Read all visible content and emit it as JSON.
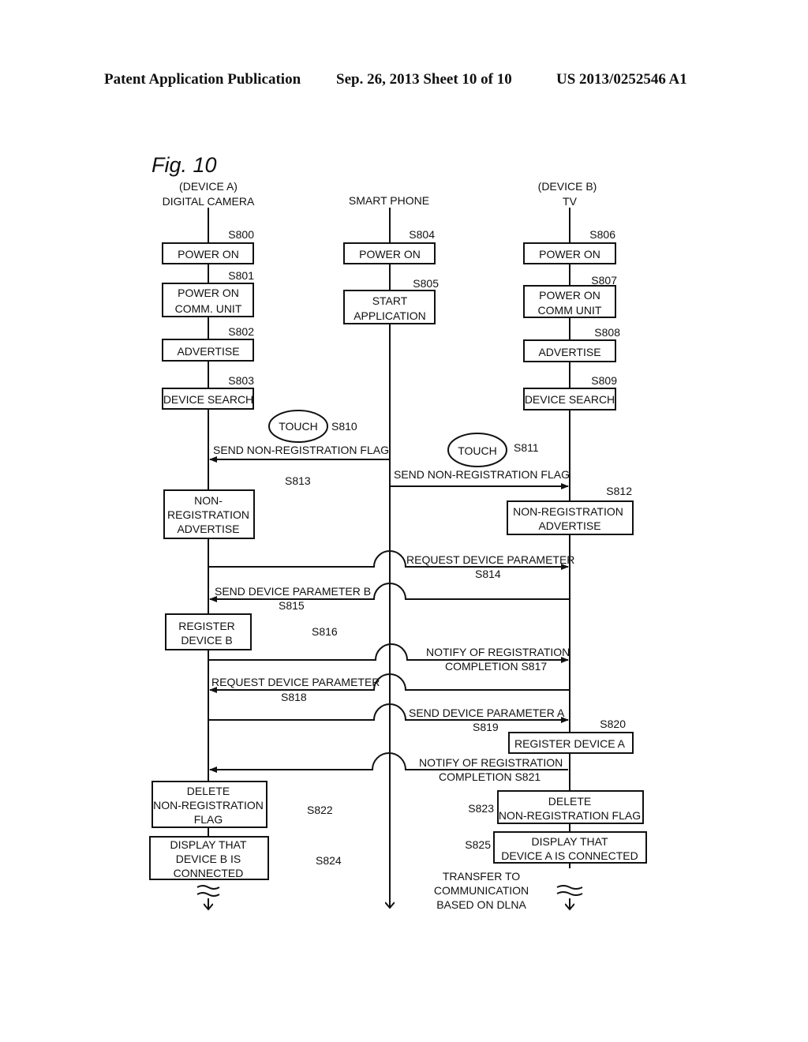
{
  "header": {
    "left": "Patent Application Publication",
    "middle": "Sep. 26, 2013   Sheet 10 of 10",
    "right": "US 2013/0252546 A1"
  },
  "figure": {
    "title": "Fig. 10",
    "lanes": {
      "device_a": {
        "line1": "(DEVICE A)",
        "line2": "DIGITAL CAMERA"
      },
      "phone": {
        "line1": "",
        "line2": "SMART PHONE"
      },
      "device_b": {
        "line1": "(DEVICE B)",
        "line2": "TV"
      }
    },
    "steps": {
      "s800": {
        "id": "S800",
        "text": [
          "POWER ON"
        ]
      },
      "s801": {
        "id": "S801",
        "text": [
          "POWER ON",
          "COMM. UNIT"
        ]
      },
      "s802": {
        "id": "S802",
        "text": [
          "ADVERTISE"
        ]
      },
      "s803": {
        "id": "S803",
        "text": [
          "DEVICE SEARCH"
        ]
      },
      "s804": {
        "id": "S804",
        "text": [
          "POWER ON"
        ]
      },
      "s805": {
        "id": "S805",
        "text": [
          "START",
          "APPLICATION"
        ]
      },
      "s806": {
        "id": "S806",
        "text": [
          "POWER ON"
        ]
      },
      "s807": {
        "id": "S807",
        "text": [
          "POWER ON",
          "COMM UNIT"
        ]
      },
      "s808": {
        "id": "S808",
        "text": [
          "ADVERTISE"
        ]
      },
      "s809": {
        "id": "S809",
        "text": [
          "DEVICE SEARCH"
        ]
      },
      "s810": {
        "id": "S810",
        "text": [
          "TOUCH"
        ]
      },
      "s811": {
        "id": "S811",
        "text": [
          "TOUCH"
        ]
      },
      "s812": {
        "id": "S812",
        "text": [
          "NON-REGISTRATION",
          "ADVERTISE"
        ]
      },
      "s813": {
        "id": "S813",
        "text": [
          "NON-",
          "REGISTRATION",
          "ADVERTISE"
        ]
      },
      "s816": {
        "id": "S816",
        "text": [
          "REGISTER",
          "DEVICE B"
        ]
      },
      "s820": {
        "id": "S820",
        "text": [
          "REGISTER DEVICE A"
        ]
      },
      "s822": {
        "id": "S822",
        "text": [
          "DELETE",
          "NON-REGISTRATION",
          "FLAG"
        ]
      },
      "s823": {
        "id": "S823",
        "text": [
          "DELETE",
          "NON-REGISTRATION FLAG"
        ]
      },
      "s824": {
        "id": "S824",
        "text": [
          "DISPLAY THAT",
          "DEVICE B IS",
          "CONNECTED"
        ]
      },
      "s825": {
        "id": "S825",
        "text": [
          "DISPLAY THAT",
          "DEVICE A IS CONNECTED"
        ]
      }
    },
    "messages": {
      "m810": {
        "text": "SEND NON-REGISTRATION FLAG"
      },
      "m811": {
        "text": "SEND NON-REGISTRATION FLAG"
      },
      "m814": {
        "text": "REQUEST DEVICE PARAMETER",
        "id": "S814"
      },
      "m815": {
        "text": "SEND DEVICE PARAMETER B",
        "id": "S815"
      },
      "m817": {
        "text1": "NOTIFY OF REGISTRATION",
        "text2": "COMPLETION  S817"
      },
      "m818": {
        "text": "REQUEST DEVICE PARAMETER",
        "id": "S818"
      },
      "m819": {
        "text": "SEND DEVICE PARAMETER A",
        "id": "S819"
      },
      "m821": {
        "text1": "NOTIFY OF REGISTRATION",
        "text2": "COMPLETION  S821"
      }
    },
    "transfer_note": [
      "TRANSFER TO",
      "COMMUNICATION",
      "BASED ON DLNA"
    ]
  }
}
